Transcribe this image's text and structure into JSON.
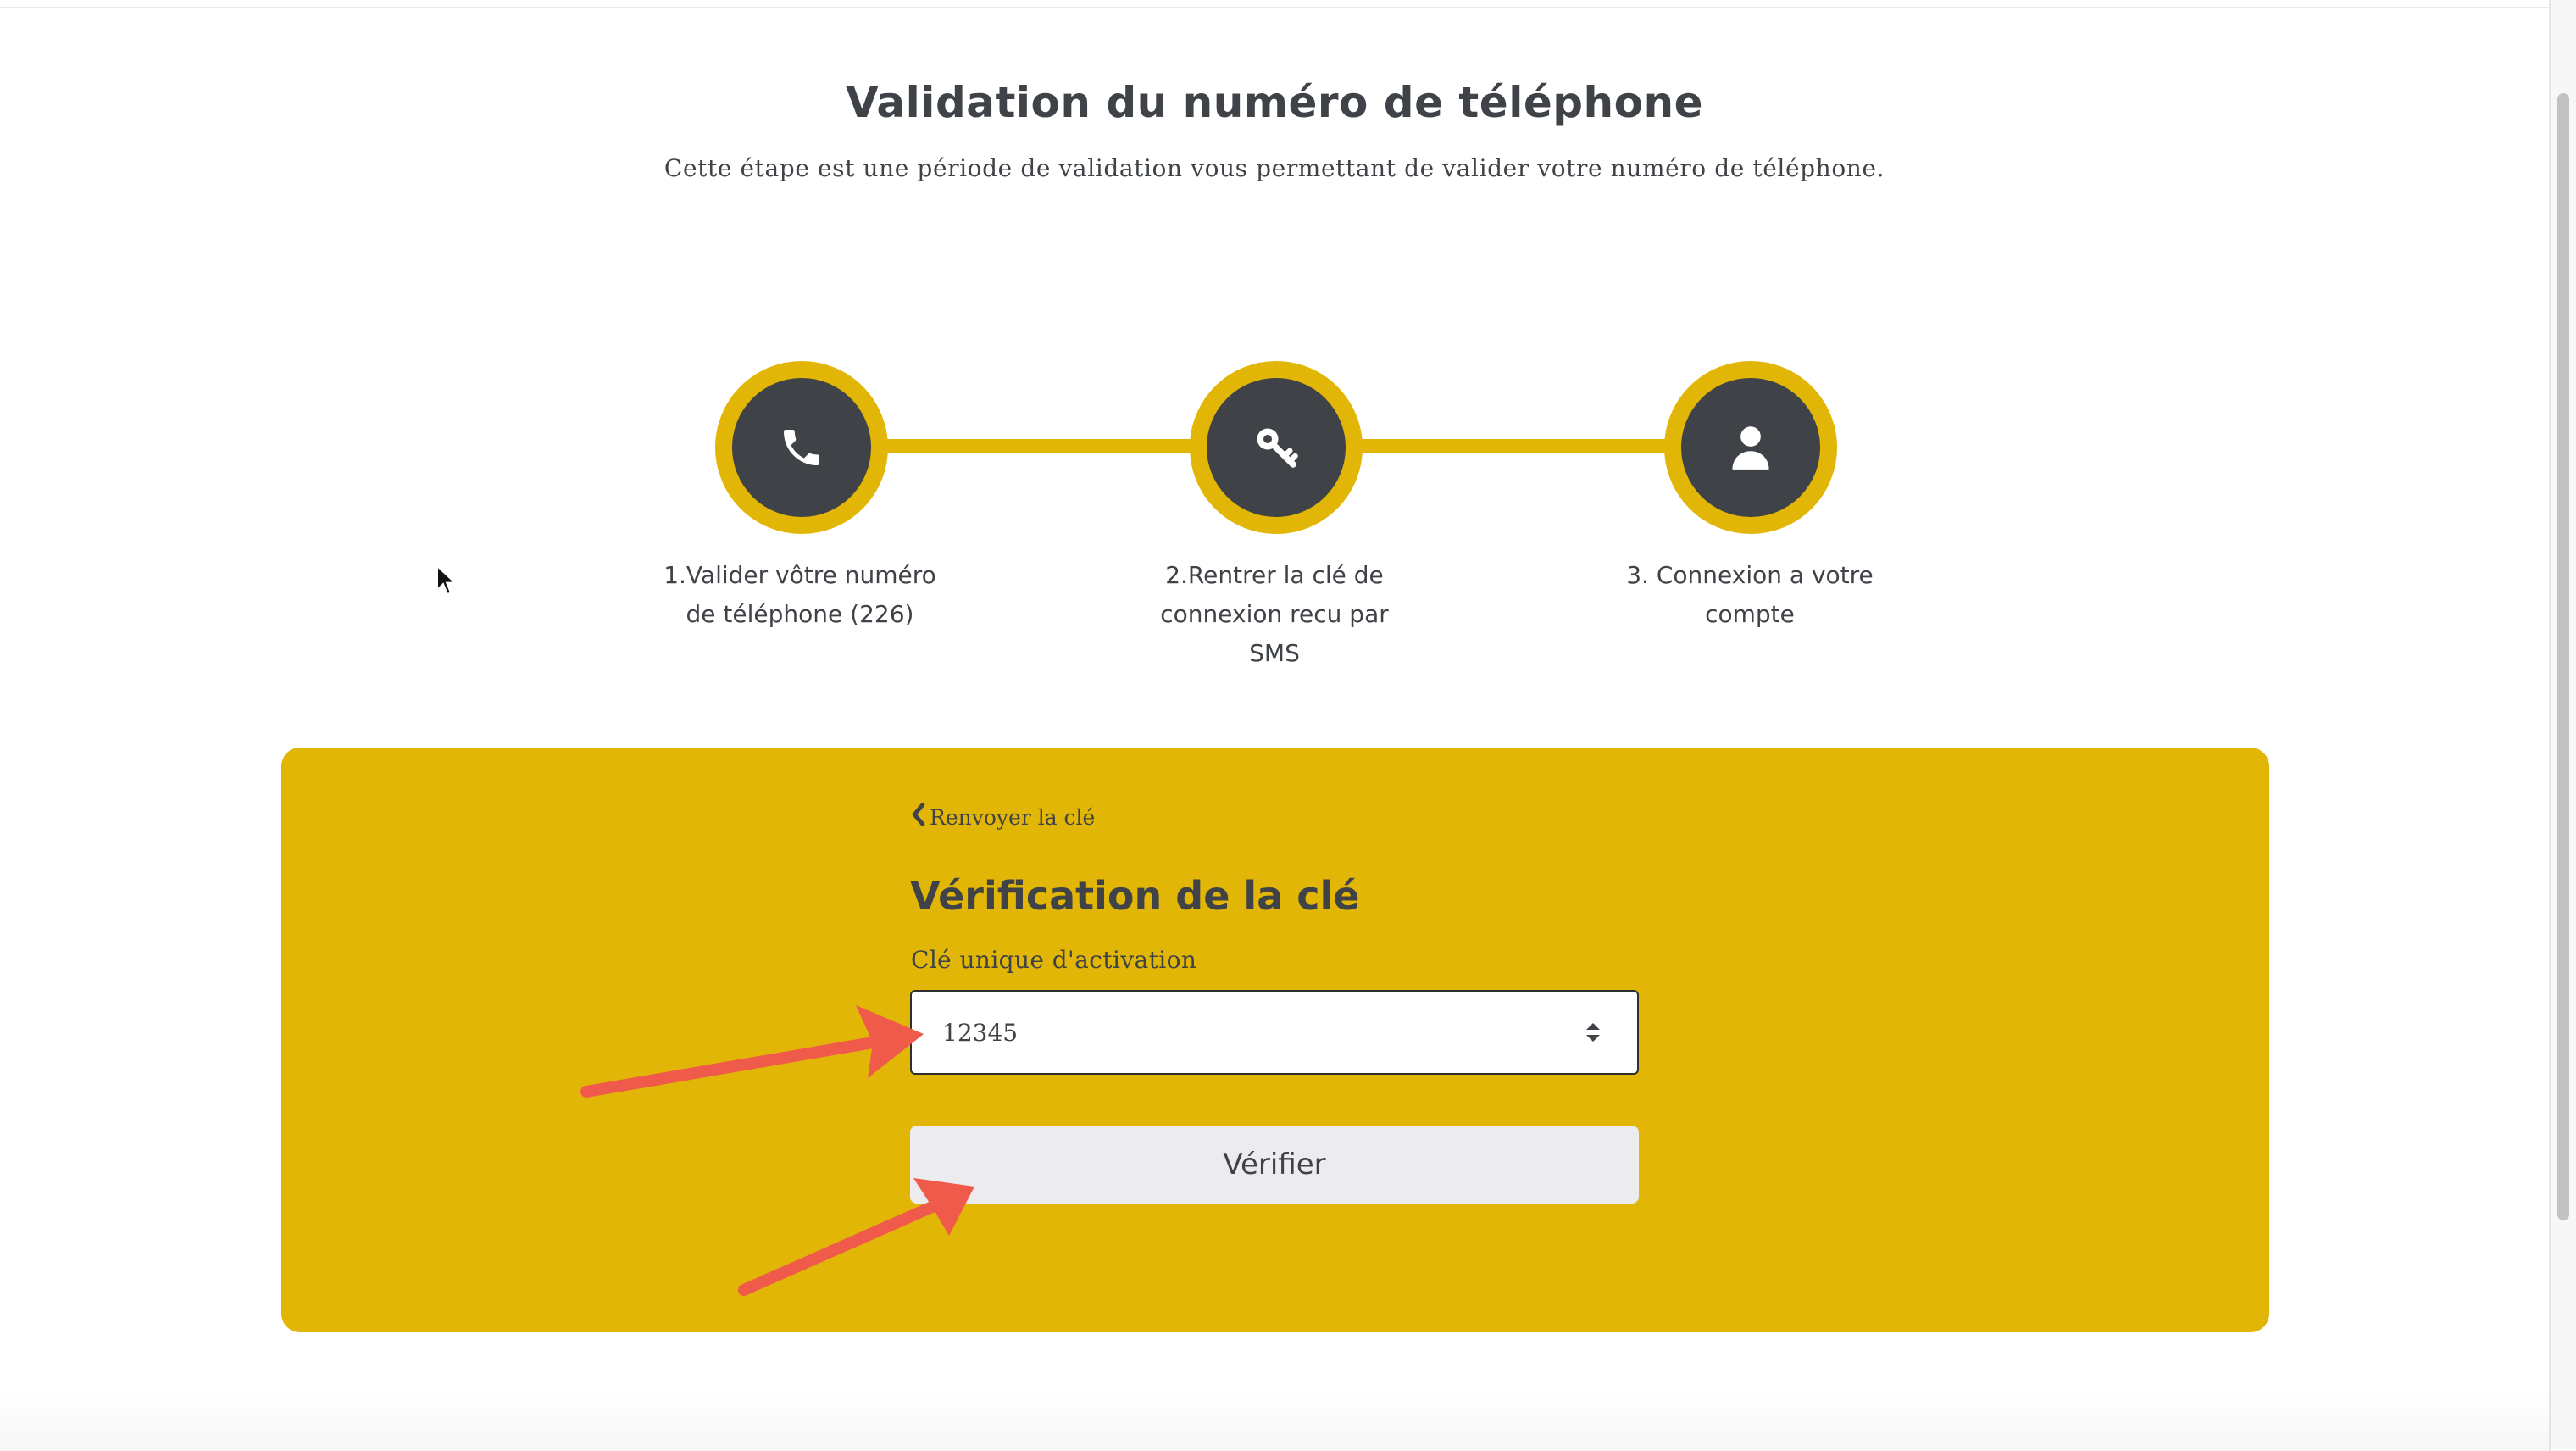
{
  "header": {
    "title": "Validation du numéro de téléphone",
    "subtitle": "Cette étape est une période de validation vous permettant de valider votre numéro de téléphone."
  },
  "steps": [
    {
      "icon": "phone-icon",
      "label": "1.Valider vôtre numéro de téléphone (226)"
    },
    {
      "icon": "key-icon",
      "label": "2.Rentrer la clé de connexion recu par SMS"
    },
    {
      "icon": "user-icon",
      "label": "3. Connexion a votre compte"
    }
  ],
  "verification": {
    "back_link": "Renvoyer la clé",
    "title": "Vérification de la clé",
    "field_label": "Clé unique d'activation",
    "field_value": "12345",
    "button_label": "Vérifier"
  },
  "colors": {
    "accent": "#e2b606",
    "dark": "#3f4347",
    "button": "#ececef",
    "annotation_arrow": "#f05a4a"
  }
}
